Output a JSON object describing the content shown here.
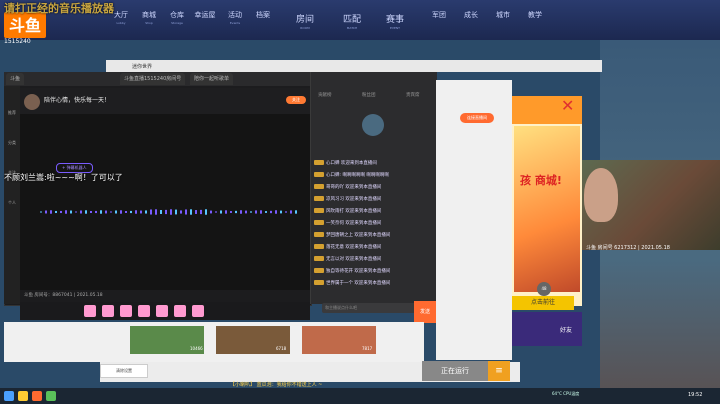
{
  "overlay_text": "请打正经的音乐播放器",
  "logo": {
    "name": "斗鱼",
    "subtitle": "房间号",
    "number": "1515240"
  },
  "game_nav": [
    {
      "label": "大厅",
      "sub": "Lobby"
    },
    {
      "label": "商城",
      "sub": "Shop"
    },
    {
      "label": "仓库",
      "sub": "Storage"
    },
    {
      "label": "幸运屋",
      "sub": ""
    },
    {
      "label": "活动",
      "sub": "Events"
    },
    {
      "label": "档案",
      "sub": ""
    },
    {
      "label": "房间",
      "sub": "ROOM"
    },
    {
      "label": "匹配",
      "sub": "MATCH"
    },
    {
      "label": "赛事",
      "sub": "EVENT"
    },
    {
      "label": "军团",
      "sub": ""
    },
    {
      "label": "成长",
      "sub": ""
    },
    {
      "label": "城市",
      "sub": ""
    },
    {
      "label": "教学",
      "sub": ""
    }
  ],
  "browser": {
    "title": "迷你世界"
  },
  "tabs": [
    "斗鱼",
    "斗鱼直播1515240房间号",
    "陪你一起听歌单"
  ],
  "sidebar": [
    "推荐",
    "分类",
    "关注",
    "个人"
  ],
  "streamer": {
    "title": "陪伴心情，快乐每一天！",
    "follow": "关注"
  },
  "danmu_tag": "+ 弹幕机器人",
  "danmu": "不顾刘兰嵩:啦~~~啊！了可以了",
  "video_info": "斗鱼 房间号：8867041 | 2021.05.18",
  "chat_tabs": [
    "贡献榜",
    "粉丝团",
    "贵宾席"
  ],
  "chat_messages": [
    "心口蝉 欢迎来到本直播间",
    "心口蝉: 啊啊啊啊啊 啊啊啊啊啊",
    "哥哥的吖 欢迎来到本直播间",
    "凉风习习 欢迎来到本直播间",
    "风吹雨打 欢迎来到本直播间",
    "一笑奈何 欢迎来到本直播间",
    "梦回唐朝之上 欢迎来到本直播间",
    "落花无意 欢迎来到本直播间",
    "无言以对 欢迎来到本直播间",
    "独自等待花开 欢迎来到本直播间",
    "世界属于一个 欢迎来到本直播间"
  ],
  "chat_input_placeholder": "和主播说点什么吧",
  "send_label": "发送",
  "light_panel": {
    "button": "连接直播间"
  },
  "ad": {
    "title": "孩 商城!",
    "go": "点击前往",
    "friend": "好友"
  },
  "webcam_caption": "斗鱼 房间号 6217312 | 2021.05.18",
  "thumbnails_count": [
    "10466",
    "6718",
    "7817"
  ],
  "task_card": "清除设置",
  "status_button": "正在运行",
  "menu_button": "≡",
  "notice": "【小喇叭】 蓝瓜泡：我给你不错送上人 ~",
  "taskbar": {
    "clock": "19:52",
    "cpu": "64°C CPU温度"
  },
  "colors": {
    "accent": "#ff6a30",
    "chat_level": "#d4a030",
    "overlay": "#c9a640"
  }
}
